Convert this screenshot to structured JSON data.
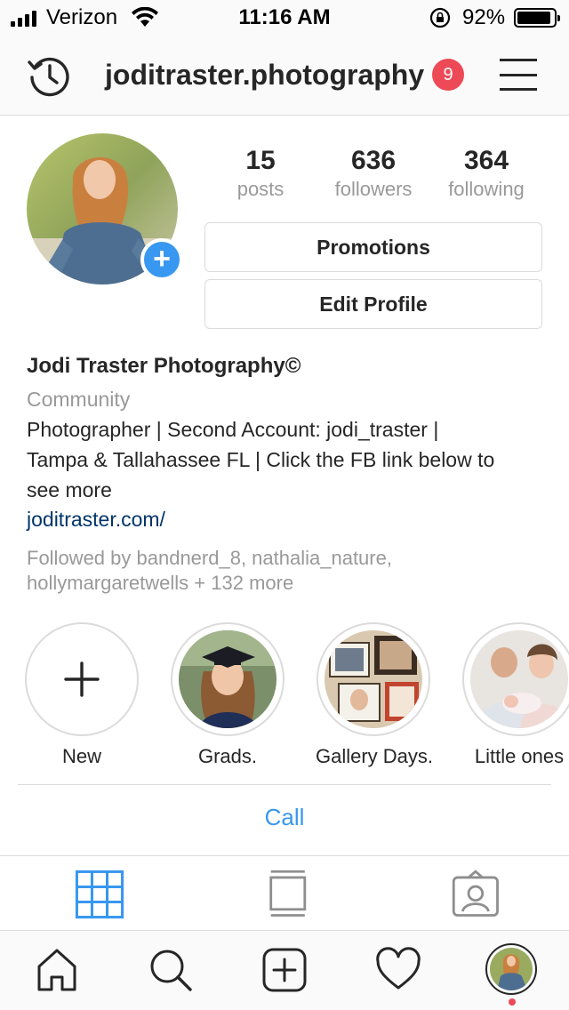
{
  "status_bar": {
    "carrier": "Verizon",
    "time": "11:16 AM",
    "battery": "92%",
    "battery_level": 0.92,
    "icons": [
      "signal-icon",
      "wifi-icon",
      "orientation-lock-icon",
      "battery-icon"
    ]
  },
  "header": {
    "username": "joditraster.photography",
    "notification_count": "9",
    "icons": [
      "history-icon",
      "menu-icon"
    ]
  },
  "stats": [
    {
      "value": "15",
      "label": "posts"
    },
    {
      "value": "636",
      "label": "followers"
    },
    {
      "value": "364",
      "label": "following"
    }
  ],
  "buttons": {
    "promotions": "Promotions",
    "edit_profile": "Edit Profile"
  },
  "bio": {
    "name": "Jodi Traster Photography©",
    "category": "Community",
    "lines": [
      "Photographer | Second Account: jodi_traster |",
      "Tampa & Tallahassee FL | Click the FB link below to",
      "see more"
    ],
    "link": "joditraster.com/",
    "followed_by": [
      "Followed by bandnerd_8, nathalia_nature,",
      "hollymargaretwells + 132 more"
    ]
  },
  "highlights": [
    {
      "label": "New",
      "icon": "plus-icon"
    },
    {
      "label": "Grads."
    },
    {
      "label": "Gallery Days."
    },
    {
      "label": "Little ones"
    }
  ],
  "call_label": "Call",
  "view_tabs": [
    "grid-icon",
    "feed-icon",
    "tagged-icon"
  ],
  "bottom_nav": [
    "home-icon",
    "search-icon",
    "new-post-icon",
    "activity-icon",
    "profile-avatar"
  ],
  "colors": {
    "accent_blue": "#3897f0",
    "notification_red": "#ed4956",
    "link_blue": "#003569",
    "secondary_text": "#999999",
    "border": "#dbdbdb"
  }
}
